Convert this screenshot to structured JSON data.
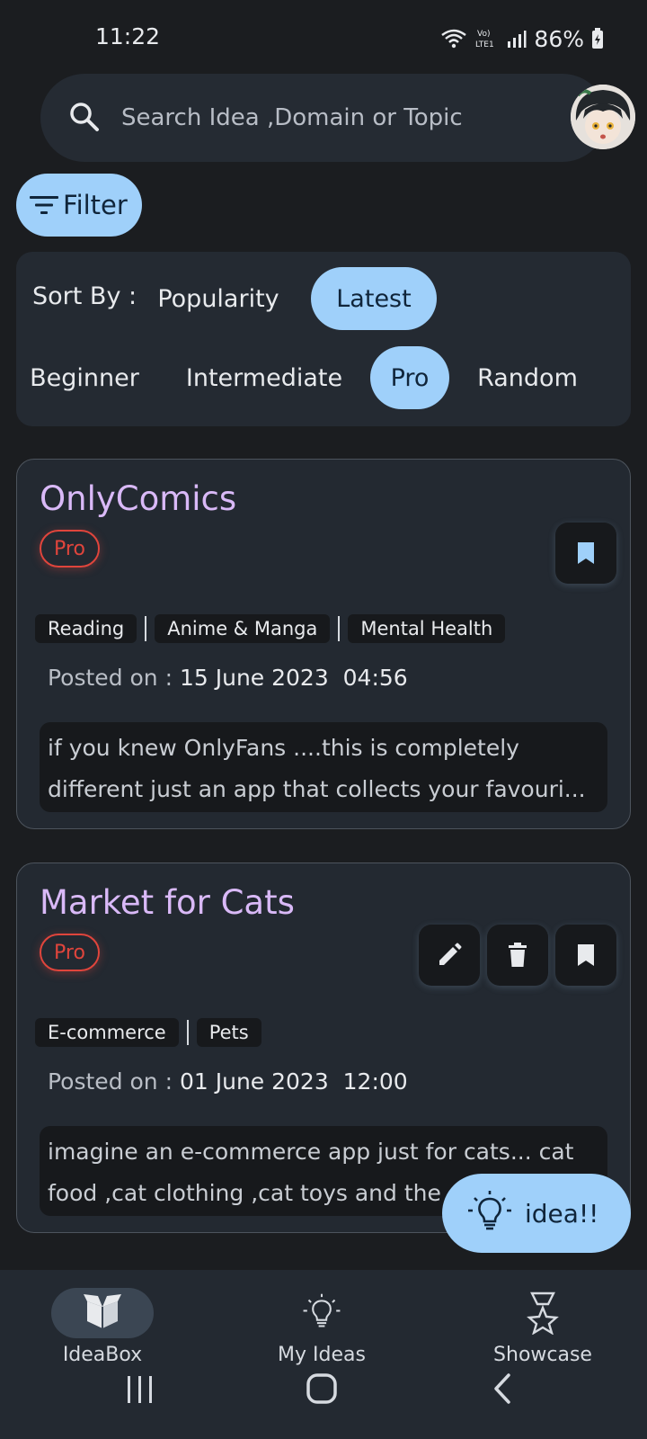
{
  "status_bar": {
    "time": "11:22",
    "battery": "86%"
  },
  "search": {
    "placeholder": "Search Idea ,Domain or Topic"
  },
  "filter": {
    "label": "Filter"
  },
  "sort": {
    "label": "Sort By :",
    "options": [
      "Popularity",
      "Latest"
    ],
    "selected_sort": "Latest",
    "levels": [
      "Beginner",
      "Intermediate",
      "Pro",
      "Random"
    ],
    "selected_level": "Pro"
  },
  "ideas": [
    {
      "title": "OnlyComics",
      "level": "Pro",
      "tags": [
        "Reading",
        "Anime & Manga",
        "Mental Health"
      ],
      "posted_label": "Posted on :",
      "date": "15 June 2023",
      "time": "04:56",
      "description_line1": "if you knew OnlyFans ....this is completely",
      "description_line2": "different  just an app that collects your favouri..."
    },
    {
      "title": "Market for Cats",
      "level": "Pro",
      "tags": [
        "E-commerce",
        "Pets"
      ],
      "posted_label": "Posted on :",
      "date": "01 June 2023",
      "time": "12:00",
      "description_line1": "imagine an e-commerce app just for cats... cat",
      "description_line2": "food ,cat clothing ,cat toys and the"
    }
  ],
  "fab": {
    "label": "idea!!"
  },
  "nav": {
    "items": [
      {
        "label": "IdeaBox",
        "icon": "box-icon"
      },
      {
        "label": "My Ideas",
        "icon": "lightbulb-icon"
      },
      {
        "label": "Showcase",
        "icon": "trophy-icon"
      }
    ],
    "active": "IdeaBox"
  },
  "colors": {
    "accent": "#9fd0fa",
    "title": "#d9b9f7",
    "pro_badge": "#e0453c",
    "background": "#1b1d20",
    "card": "#232931"
  }
}
